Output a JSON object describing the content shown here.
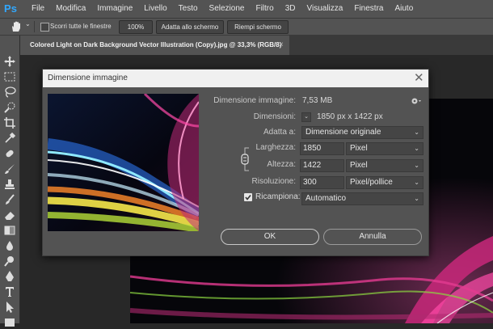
{
  "app": {
    "logo": "Ps"
  },
  "menu": [
    "File",
    "Modifica",
    "Immagine",
    "Livello",
    "Testo",
    "Selezione",
    "Filtro",
    "3D",
    "Visualizza",
    "Finestra",
    "Aiuto"
  ],
  "options_bar": {
    "scroll_all_label": "Scorri tutte le finestre",
    "zoom_100": "100%",
    "fit_screen": "Adatta allo schermo",
    "fill_screen": "Riempi schermo"
  },
  "document_tab": {
    "title": "Colored Light on Dark Background Vector Illustration (Copy).jpg @ 33,3% (RGB/8)",
    "close": "×"
  },
  "dialog": {
    "title": "Dimensione immagine",
    "close": "✕",
    "image_size_label": "Dimensione immagine:",
    "image_size_value": "7,53 MB",
    "dimensions_label": "Dimensioni:",
    "dimensions_value": "1850 px x 1422 px",
    "fit_label": "Adatta a:",
    "fit_value": "Dimensione originale",
    "width_label": "Larghezza:",
    "width_value": "1850",
    "width_unit": "Pixel",
    "height_label": "Altezza:",
    "height_value": "1422",
    "height_unit": "Pixel",
    "resolution_label": "Risoluzione:",
    "resolution_value": "300",
    "resolution_unit": "Pixel/pollice",
    "resample_label": "Ricampiona:",
    "resample_value": "Automatico",
    "resample_checked": true,
    "ok_label": "OK",
    "cancel_label": "Annulla"
  },
  "icons": {
    "hand": "hand-icon",
    "gear": "gear-icon",
    "link": "link-chain-icon",
    "caret": "chevron-down-icon",
    "check": "checkmark-icon"
  },
  "colors": {
    "ps_blue": "#31a8ff",
    "panel": "#535353",
    "canvas": "#282828"
  }
}
